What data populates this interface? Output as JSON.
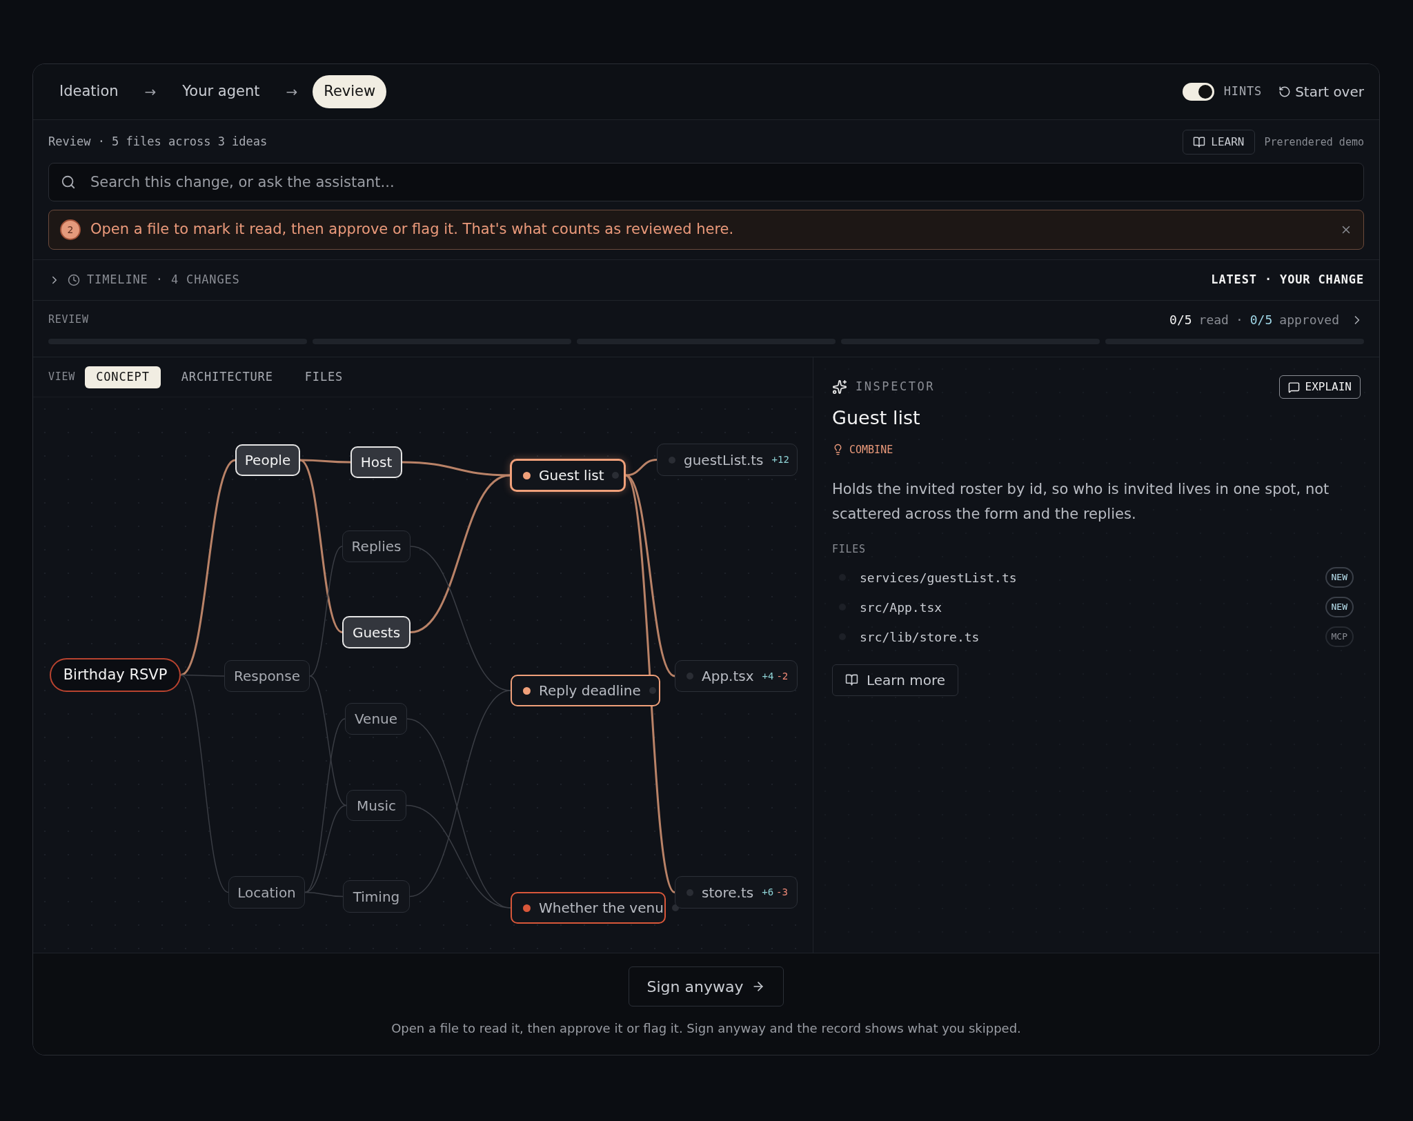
{
  "steps": [
    {
      "label": "Ideation",
      "selected": false
    },
    {
      "label": "→",
      "kind": "arrow"
    },
    {
      "label": "Your agent",
      "selected": false
    },
    {
      "label": "→",
      "kind": "arrow"
    },
    {
      "label": "Review",
      "selected": true
    }
  ],
  "hints": {
    "label": "HINTS",
    "on": true
  },
  "start_over": "Start over",
  "summary": "Review · 5 files across 3 ideas",
  "learn_button": "LEARN",
  "demo_note": "Prerendered demo",
  "search": {
    "placeholder": "Search this change, or ask the assistant..."
  },
  "banner": {
    "number": "2",
    "text": "Open a file to mark it read, then approve or flag it. That's what counts as reviewed here."
  },
  "timeline": {
    "expanded": false,
    "label": "TIMELINE · 4 CHANGES",
    "latest": "LATEST · YOUR CHANGE"
  },
  "review": {
    "label": "REVIEW",
    "read_count": "0/5",
    "read_label": "read",
    "sep": "·",
    "approved_count": "0/5",
    "approved_label": "approved",
    "segments": [
      {
        "level": 0
      },
      {
        "level": 0
      },
      {
        "level": 0
      },
      {
        "level": 0
      },
      {
        "level": 0
      }
    ]
  },
  "view": {
    "label": "VIEW",
    "tabs": [
      {
        "label": "CONCEPT",
        "selected": true
      },
      {
        "label": "ARCHITECTURE",
        "selected": false
      },
      {
        "label": "FILES",
        "selected": false
      }
    ]
  },
  "graph": {
    "nodes": [
      {
        "label": "Birthday RSVP",
        "kind": "root",
        "highlighted": true
      },
      {
        "label": "People",
        "kind": "group",
        "highlighted": true
      },
      {
        "label": "Host",
        "kind": "group",
        "highlighted": true
      },
      {
        "label": "Replies",
        "kind": "concept",
        "highlighted": false
      },
      {
        "label": "Guests",
        "kind": "group",
        "highlighted": true
      },
      {
        "label": "Response",
        "kind": "concept",
        "highlighted": false
      },
      {
        "label": "Venue",
        "kind": "concept",
        "highlighted": false
      },
      {
        "label": "Music",
        "kind": "concept",
        "highlighted": false
      },
      {
        "label": "Location",
        "kind": "concept",
        "highlighted": false
      },
      {
        "label": "Timing",
        "kind": "concept",
        "highlighted": false
      },
      {
        "label": "Guest list",
        "kind": "idea",
        "highlighted": true,
        "selected": true,
        "color": "#f0a07a"
      },
      {
        "label": "Reply deadline",
        "kind": "idea",
        "highlighted": false,
        "selected": false,
        "color": "#f0a07a"
      },
      {
        "label": "Whether the venu",
        "kind": "idea",
        "highlighted": false,
        "selected": false,
        "color": "#d9573a"
      },
      {
        "label": "guestList.ts",
        "kind": "file",
        "highlighted": true,
        "added": "+12"
      },
      {
        "label": "App.tsx",
        "kind": "file",
        "highlighted": true,
        "added": "+4",
        "removed": "-2"
      },
      {
        "label": "store.ts",
        "kind": "file",
        "highlighted": true,
        "added": "+6",
        "removed": "-3"
      }
    ]
  },
  "inspector": {
    "label": "INSPECTOR",
    "explain": "EXPLAIN",
    "title": "Guest list",
    "tag": "COMBINE",
    "description": "Holds the invited roster by id, so who is invited lives in one spot, not scattered across the form and the replies.",
    "files_label": "FILES",
    "files": [
      {
        "path": "services/guestList.ts",
        "badge": "NEW",
        "kind": "new"
      },
      {
        "path": "src/App.tsx",
        "badge": "NEW",
        "kind": "new"
      },
      {
        "path": "src/lib/store.ts",
        "badge": "MCP",
        "kind": "mcp"
      }
    ],
    "learn_more": "Learn more"
  },
  "footer": {
    "button": "Sign anyway",
    "note": "Open a file to read it, then approve it or flag it. Sign anyway and the record shows what you skipped."
  }
}
